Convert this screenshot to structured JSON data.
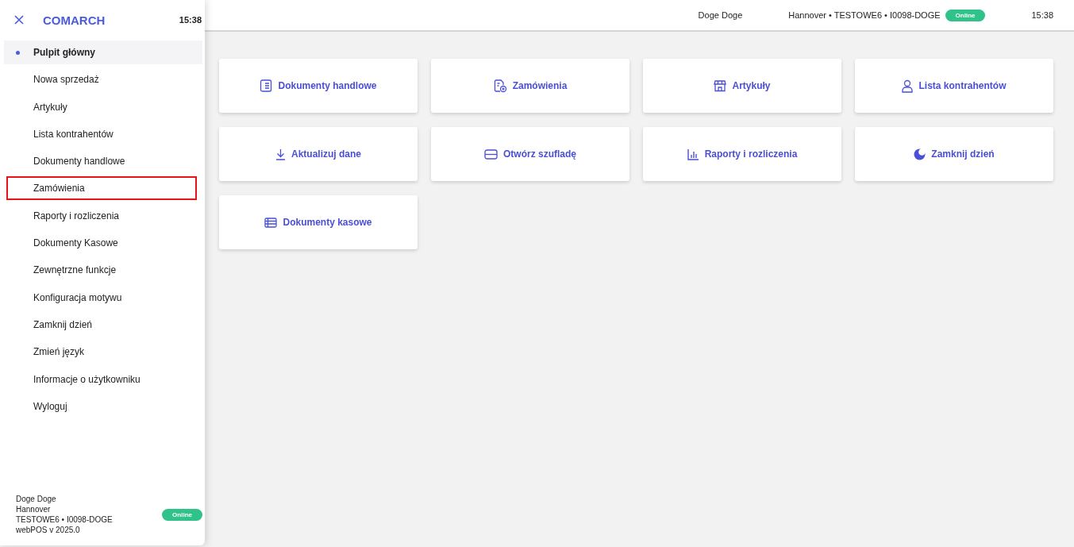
{
  "topbar": {
    "user": "Doge Doge",
    "location": "Hannover • TESTOWE6 • I0098-DOGE",
    "status": "Online",
    "time": "15:38"
  },
  "tiles": [
    {
      "kind": "list",
      "label": "Dokumenty handlowe"
    },
    {
      "kind": "order",
      "label": "Zamówienia"
    },
    {
      "kind": "shop",
      "label": "Artykuły"
    },
    {
      "kind": "person",
      "label": "Lista kontrahentów"
    },
    {
      "kind": "download",
      "label": "Aktualizuj dane"
    },
    {
      "kind": "card",
      "label": "Otwórz szufladę"
    },
    {
      "kind": "chart",
      "label": "Raporty i rozliczenia"
    },
    {
      "kind": "moon",
      "label": "Zamknij dzień"
    },
    {
      "kind": "table",
      "label": "Dokumenty kasowe"
    }
  ],
  "drawer": {
    "logo": "COMARCH",
    "time": "15:38",
    "items": [
      {
        "label": "Pulpit główny",
        "selected": true,
        "highlighted": false
      },
      {
        "label": "Nowa sprzedaż",
        "selected": false,
        "highlighted": false
      },
      {
        "label": "Artykuły",
        "selected": false,
        "highlighted": false
      },
      {
        "label": "Lista kontrahentów",
        "selected": false,
        "highlighted": false
      },
      {
        "label": "Dokumenty handlowe",
        "selected": false,
        "highlighted": false
      },
      {
        "label": "Zamówienia",
        "selected": false,
        "highlighted": true
      },
      {
        "label": "Raporty i rozliczenia",
        "selected": false,
        "highlighted": false
      },
      {
        "label": "Dokumenty Kasowe",
        "selected": false,
        "highlighted": false
      },
      {
        "label": "Zewnętrzne funkcje",
        "selected": false,
        "highlighted": false
      },
      {
        "label": "Konfiguracja motywu",
        "selected": false,
        "highlighted": false
      },
      {
        "label": "Zamknij dzień",
        "selected": false,
        "highlighted": false
      },
      {
        "label": "Zmień język",
        "selected": false,
        "highlighted": false
      },
      {
        "label": "Informacje o użytkowniku",
        "selected": false,
        "highlighted": false
      },
      {
        "label": "Wyloguj",
        "selected": false,
        "highlighted": false
      }
    ],
    "footer": {
      "lines": [
        "Doge Doge",
        "Hannover",
        "TESTOWE6 • I0098-DOGE",
        "webPOS v 2025.0"
      ],
      "status": "Online"
    }
  }
}
